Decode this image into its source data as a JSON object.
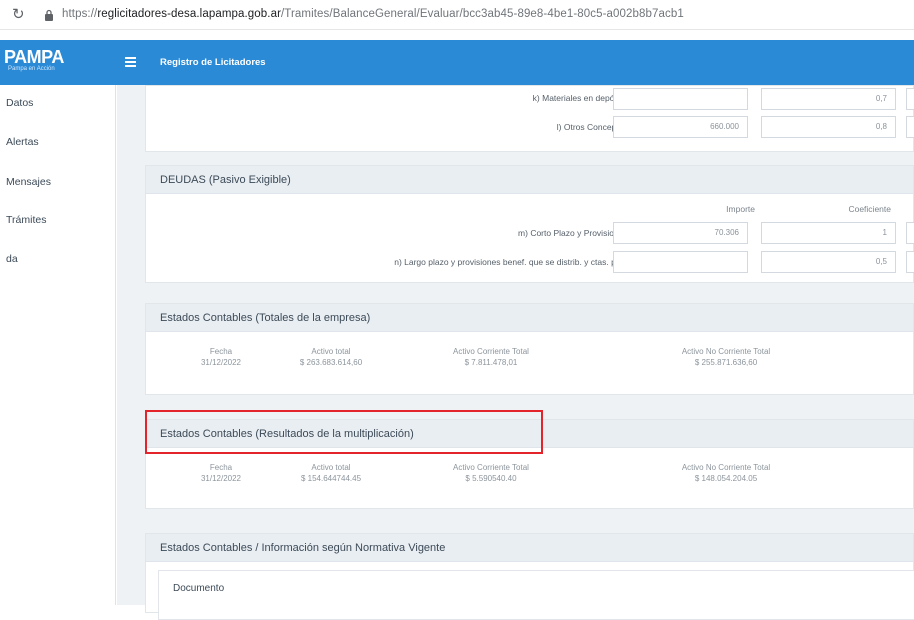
{
  "browser": {
    "url_prefix": "https://",
    "url_host": "reglicitadores-desa.lapampa.gob.ar",
    "url_path": "/Tramites/BalanceGeneral/Evaluar/bcc3ab45-89e8-4be1-80c5-a002b8b7acb1"
  },
  "app": {
    "logo": "PAMPA",
    "logo_sub": "Pampa en Acción",
    "title": "Registro de Licitadores"
  },
  "sidebar": {
    "items": [
      "Datos",
      "Alertas",
      "Mensajes",
      "Trámites",
      "da"
    ]
  },
  "activo_section": {
    "rows": [
      {
        "label": "k) Materiales en depósito:",
        "importe": "",
        "coef": "0,7"
      },
      {
        "label": "l) Otros Conceptos:",
        "importe": "660.000",
        "coef": "0,8"
      }
    ]
  },
  "deudas": {
    "title": "DEUDAS (Pasivo Exigible)",
    "col_importe": "Importe",
    "col_coef": "Coeficiente",
    "rows": [
      {
        "label": "m) Corto Plazo y Provisiones:",
        "importe": "70.306",
        "coef": "1"
      },
      {
        "label": "n) Largo plazo y provisiones benef. que se distrib. y ctas. pag.:",
        "importe": "",
        "coef": "0,5"
      }
    ]
  },
  "totales": {
    "title": "Estados Contables (Totales de la empresa)",
    "fecha_label": "Fecha",
    "fecha": "31/12/2022",
    "activo_total_label": "Activo total",
    "activo_total": "$ 263.683.614,60",
    "corriente_label": "Activo Corriente Total",
    "corriente": "$ 7.811.478,01",
    "no_corriente_label": "Activo No Corriente Total",
    "no_corriente": "$ 255.871.636,60"
  },
  "resultados": {
    "title": "Estados Contables (Resultados de la multiplicación)",
    "fecha_label": "Fecha",
    "fecha": "31/12/2022",
    "activo_total_label": "Activo total",
    "activo_total": "$ 154.644744.45",
    "corriente_label": "Activo Corriente Total",
    "corriente": "$ 5.590540.40",
    "no_corriente_label": "Activo No Corriente Total",
    "no_corriente": "$ 148.054.204.05"
  },
  "normativa": {
    "title": "Estados Contables / Información según Normativa Vigente",
    "doc_label": "Documento"
  },
  "colors": {
    "header": "#2b8ad6",
    "highlight": "#e3242b"
  }
}
